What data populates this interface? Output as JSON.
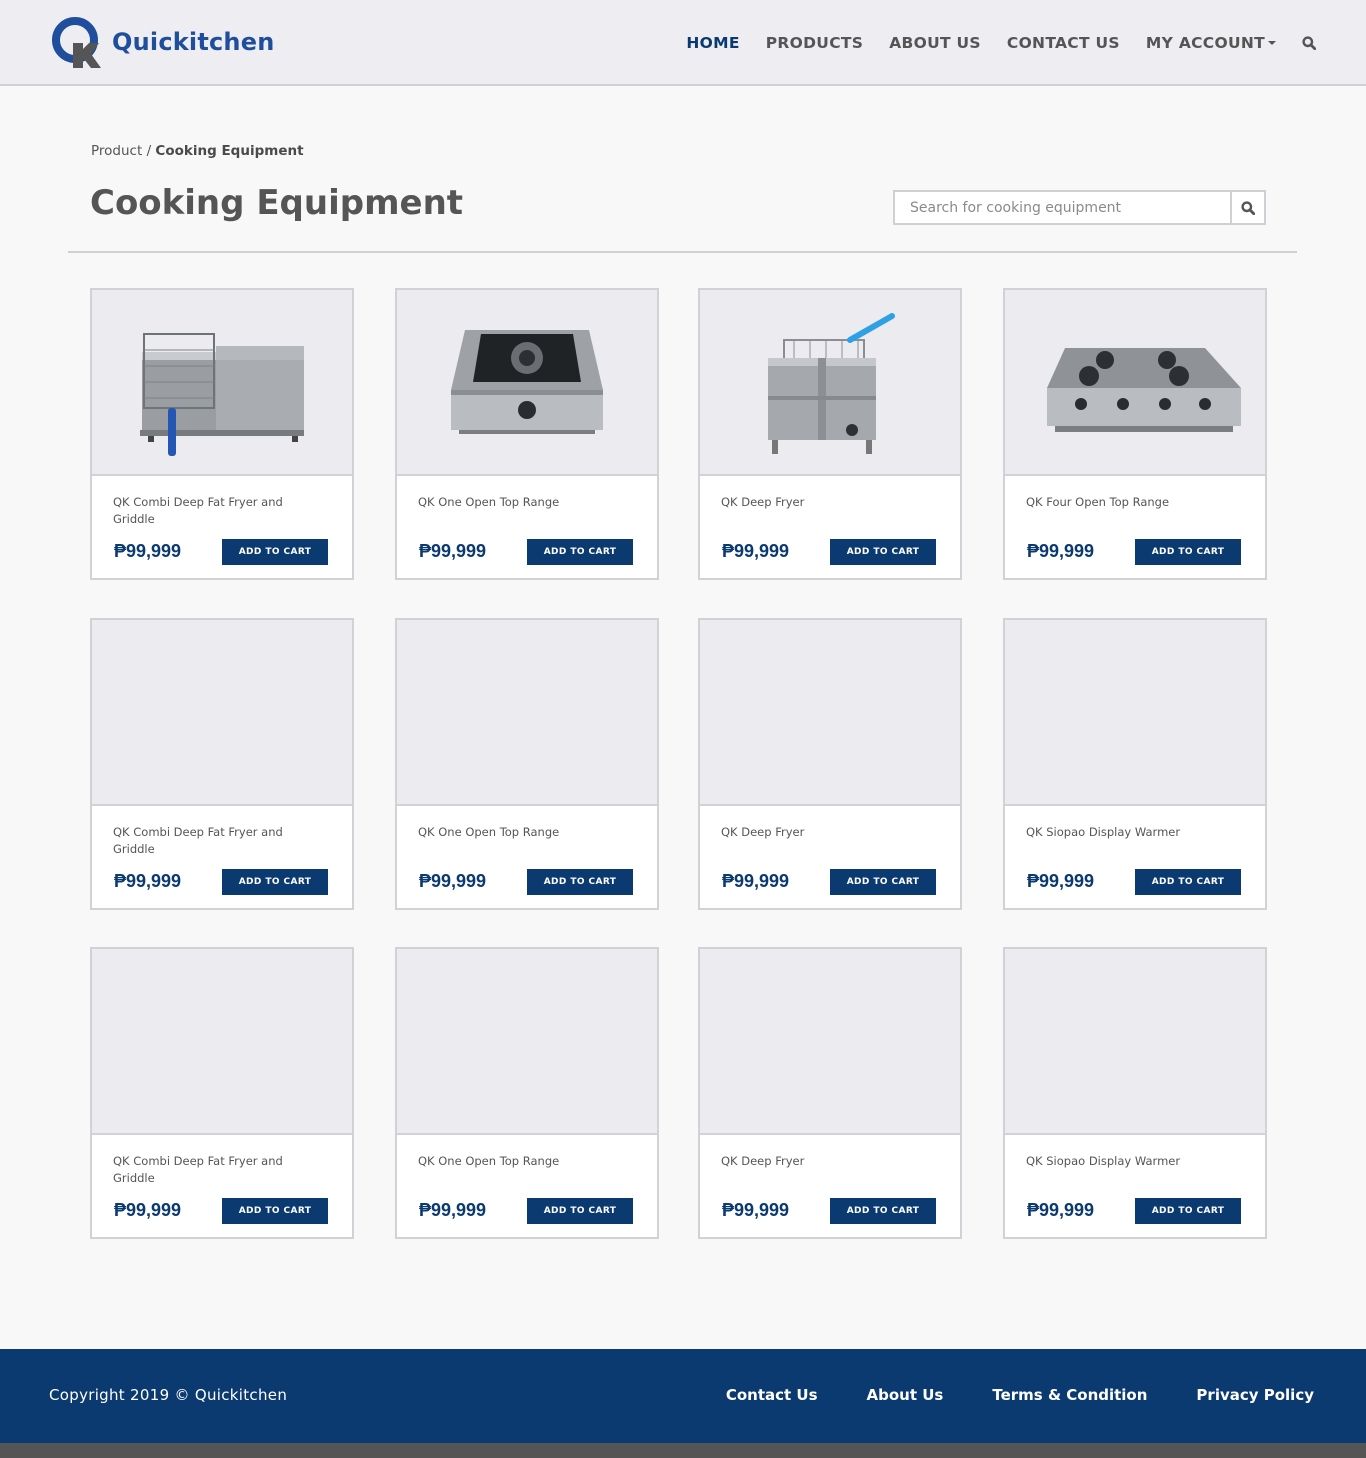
{
  "brand": {
    "name": "Quickitchen",
    "color_primary": "#1f4e9c",
    "color_dark": "#0b3a70"
  },
  "nav": {
    "items": [
      {
        "label": "HOME",
        "active": true
      },
      {
        "label": "PRODUCTS",
        "active": false
      },
      {
        "label": "ABOUT US",
        "active": false
      },
      {
        "label": "CONTACT US",
        "active": false
      },
      {
        "label": "MY ACCOUNT",
        "active": false,
        "dropdown": true
      }
    ],
    "search_icon": "search-icon"
  },
  "breadcrumb": {
    "parent": "Product",
    "separator": "/",
    "current": "Cooking Equipment"
  },
  "page": {
    "title": "Cooking Equipment"
  },
  "search": {
    "placeholder": "Search for cooking equipment",
    "value": ""
  },
  "products": [
    {
      "name": "QK Combi Deep Fat Fryer and Griddle",
      "price": "₱99,999",
      "button": "ADD TO CART",
      "image": "combi-fryer-griddle"
    },
    {
      "name": "QK One Open Top Range",
      "price": "₱99,999",
      "button": "ADD TO CART",
      "image": "one-open-top-range"
    },
    {
      "name": "QK Deep Fryer",
      "price": "₱99,999",
      "button": "ADD TO CART",
      "image": "deep-fryer"
    },
    {
      "name": "QK Four Open Top Range",
      "price": "₱99,999",
      "button": "ADD TO CART",
      "image": "four-open-top-range"
    },
    {
      "name": "QK Combi Deep Fat Fryer and Griddle",
      "price": "₱99,999",
      "button": "ADD TO CART",
      "image": "placeholder"
    },
    {
      "name": "QK One Open Top Range",
      "price": "₱99,999",
      "button": "ADD TO CART",
      "image": "placeholder"
    },
    {
      "name": "QK Deep Fryer",
      "price": "₱99,999",
      "button": "ADD TO CART",
      "image": "placeholder"
    },
    {
      "name": "QK Siopao Display Warmer",
      "price": "₱99,999",
      "button": "ADD TO CART",
      "image": "placeholder"
    },
    {
      "name": "QK Combi Deep Fat Fryer and Griddle",
      "price": "₱99,999",
      "button": "ADD TO CART",
      "image": "placeholder"
    },
    {
      "name": "QK One Open Top Range",
      "price": "₱99,999",
      "button": "ADD TO CART",
      "image": "placeholder"
    },
    {
      "name": "QK Deep Fryer",
      "price": "₱99,999",
      "button": "ADD TO CART",
      "image": "placeholder"
    },
    {
      "name": "QK Siopao Display Warmer",
      "price": "₱99,999",
      "button": "ADD TO CART",
      "image": "placeholder"
    }
  ],
  "footer": {
    "copyright": "Copyright 2019 © Quickitchen",
    "links": [
      "Contact Us",
      "About Us",
      "Terms & Condition",
      "Privacy Policy"
    ]
  }
}
